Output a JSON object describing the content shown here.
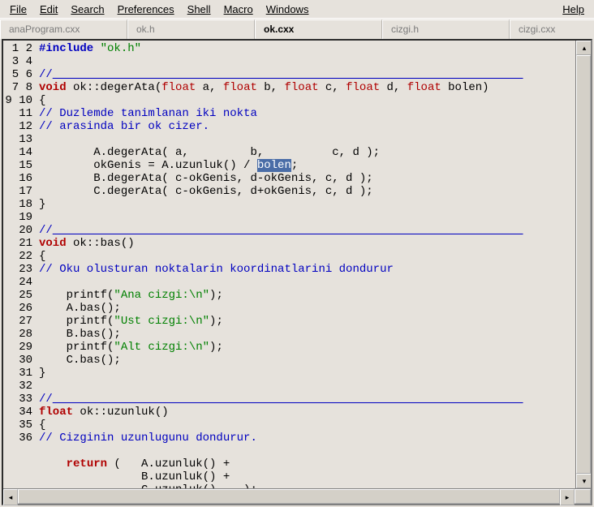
{
  "menu": {
    "file": "File",
    "edit": "Edit",
    "search": "Search",
    "prefs": "Preferences",
    "shell": "Shell",
    "macro": "Macro",
    "windows": "Windows",
    "help": "Help"
  },
  "tabs": [
    {
      "label": "anaProgram.cxx",
      "active": false
    },
    {
      "label": "ok.h",
      "active": false
    },
    {
      "label": "ok.cxx",
      "active": true
    },
    {
      "label": "cizgi.h",
      "active": false
    },
    {
      "label": "cizgi.cxx",
      "active": false
    }
  ],
  "close_glyph": "×",
  "line_numbers": [
    "1",
    "2",
    "3",
    "4",
    "5",
    "6",
    "7",
    "8",
    "9",
    "10",
    "11",
    "12",
    "13",
    "14",
    "15",
    "16",
    "17",
    "18",
    "19",
    "20",
    "21",
    "22",
    "23",
    "24",
    "25",
    "26",
    "27",
    "28",
    "29",
    "30",
    "31",
    "32",
    "33",
    "34",
    "35",
    "36"
  ],
  "code": {
    "l1": {
      "pre": "#include",
      "sp": " ",
      "str": "\"ok.h\""
    },
    "l2": "",
    "l3": {
      "cmt_pre": "//",
      "rule": "_____________________________________________________________________"
    },
    "l4": {
      "kw1": "void",
      "mid": " ok::degerAta(",
      "ty": "float",
      "a": " a, ",
      "b": " b, ",
      "c": " c, ",
      "d": " d, ",
      "e": " bolen)"
    },
    "l5": "{",
    "l6": {
      "cmt": "// Duzlemde tanimlanan iki nokta"
    },
    "l7": {
      "cmt": "// arasinda bir ok cizer."
    },
    "l8": "",
    "l9": "        A.degerAta( a,         b,          c, d );",
    "l10": {
      "pre": "        okGenis = A.uzunluk() / ",
      "sel": "bolen",
      "post": ";"
    },
    "l11": "        B.degerAta( c-okGenis, d-okGenis, c, d );",
    "l12": "        C.degerAta( c-okGenis, d+okGenis, c, d );",
    "l13": "}",
    "l14": "",
    "l15": {
      "cmt_pre": "//",
      "rule": "_____________________________________________________________________"
    },
    "l16": {
      "kw": "void",
      "rest": " ok::bas()"
    },
    "l17": "{",
    "l18": {
      "cmt": "// Oku olusturan noktalarin koordinatlarini dondurur"
    },
    "l19": "",
    "l20": {
      "pre": "    printf(",
      "str": "\"Ana cizgi:\\n\"",
      "post": ");"
    },
    "l21": "    A.bas();",
    "l22": {
      "pre": "    printf(",
      "str": "\"Ust cizgi:\\n\"",
      "post": ");"
    },
    "l23": "    B.bas();",
    "l24": {
      "pre": "    printf(",
      "str": "\"Alt cizgi:\\n\"",
      "post": ");"
    },
    "l25": "    C.bas();",
    "l26": "}",
    "l27": "",
    "l28": {
      "cmt_pre": "//",
      "rule": "_____________________________________________________________________"
    },
    "l29": {
      "kw": "float",
      "rest": " ok::uzunluk()"
    },
    "l30": "{",
    "l31": {
      "cmt": "// Cizginin uzunlugunu dondurur."
    },
    "l32": "",
    "l33": {
      "pre": "    ",
      "kw": "return",
      "post": " (   A.uzunluk() +"
    },
    "l34": "               B.uzunluk() +",
    "l35": "               C.uzunluk()    );",
    "l36": "}"
  },
  "scroll": {
    "up": "▴",
    "down": "▾",
    "left": "◂",
    "right": "▸"
  }
}
